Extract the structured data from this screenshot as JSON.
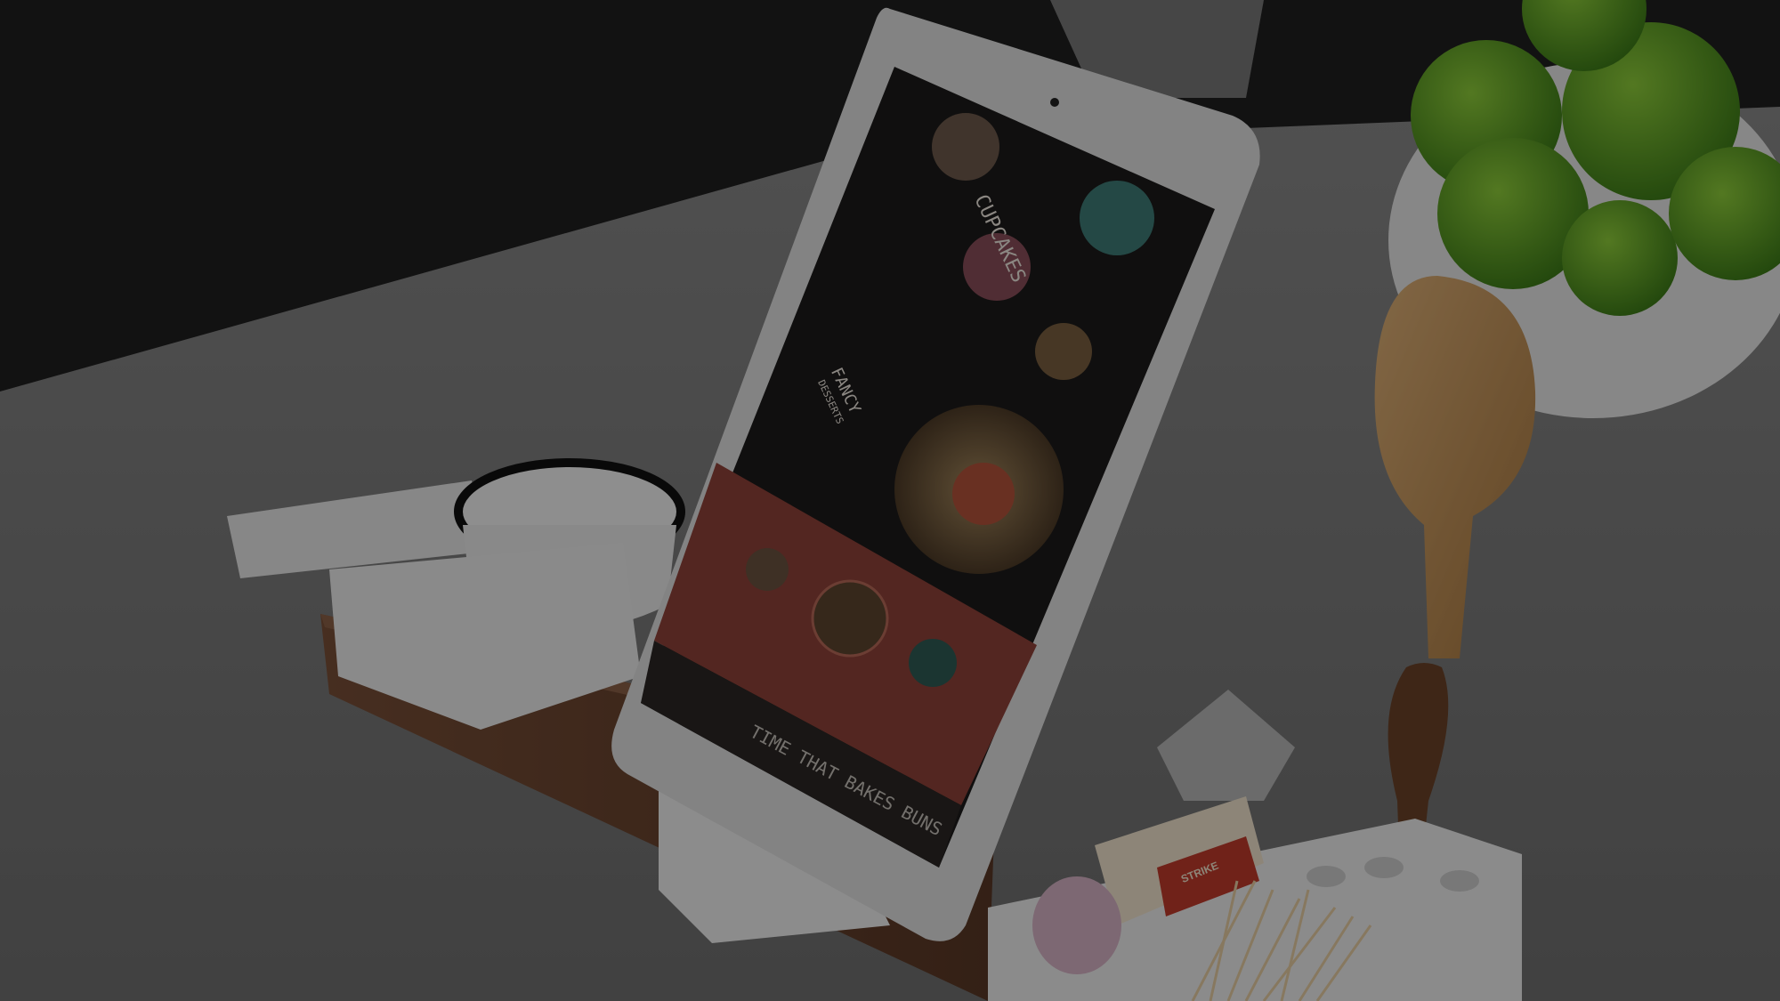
{
  "tablet_screen": {
    "hero_title": "CUPCAKES",
    "section_title_line1": "FANCY",
    "section_title_line2": "DESSERTS",
    "bottom_banner": "TIME THAT BAKES BUNS"
  },
  "matchbox": {
    "label": "STRIKE"
  },
  "colors": {
    "wall": "#141414",
    "counter": "#6c6c6c",
    "tablet_frame": "#d8d8d8",
    "screen_dark": "#1d1b1a",
    "screen_red": "#7a3a34",
    "wood": "#4b2f22",
    "lime": "#4d8d1f",
    "spoon": "#9a7240"
  }
}
